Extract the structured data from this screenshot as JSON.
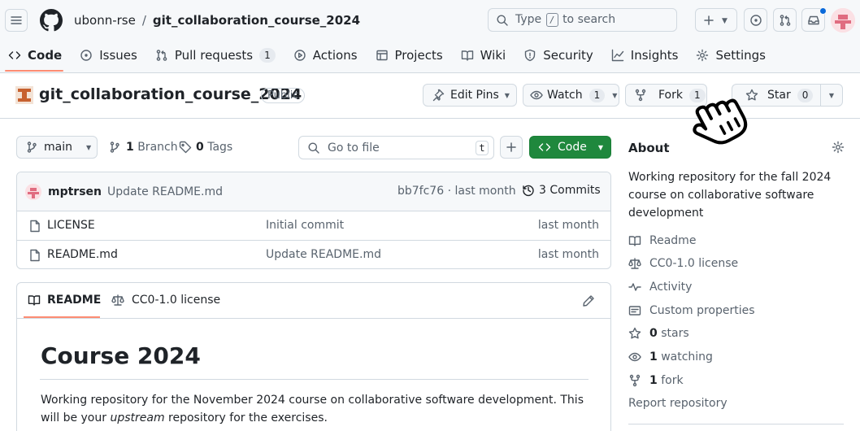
{
  "header": {
    "owner": "ubonn-rse",
    "separator": "/",
    "repo": "git_collaboration_course_2024",
    "search_pre": "Type",
    "search_key": "/",
    "search_post": "to search"
  },
  "nav": {
    "code": "Code",
    "issues": "Issues",
    "pull_requests": "Pull requests",
    "pull_requests_count": "1",
    "actions": "Actions",
    "projects": "Projects",
    "wiki": "Wiki",
    "security": "Security",
    "insights": "Insights",
    "settings": "Settings"
  },
  "repo_header": {
    "name": "git_collaboration_course_2024",
    "visibility": "Public",
    "edit_pins": "Edit Pins",
    "watch": "Watch",
    "watch_count": "1",
    "fork": "Fork",
    "fork_count": "1",
    "star": "Star",
    "star_count": "0"
  },
  "toolbar": {
    "branch": "main",
    "branch_count": "1",
    "branch_label": "Branch",
    "tag_count": "0",
    "tag_label": "Tags",
    "goto_placeholder": "Go to file",
    "goto_key": "t",
    "code_button": "Code"
  },
  "latest_commit": {
    "author": "mptrsen",
    "message": "Update README.md",
    "meta": "bb7fc76 · last month",
    "commits": "3 Commits"
  },
  "files": [
    {
      "name": "LICENSE",
      "message": "Initial commit",
      "date": "last month"
    },
    {
      "name": "README.md",
      "message": "Update README.md",
      "date": "last month"
    }
  ],
  "readme": {
    "tab_readme": "README",
    "tab_license": "CC0-1.0 license",
    "heading": "Course 2024",
    "para_pre": "Working repository for the November 2024 course on collaborative software development. This will be your ",
    "para_em": "upstream",
    "para_post": " repository for the exercises."
  },
  "about": {
    "title": "About",
    "description": "Working repository for the fall 2024 course on collaborative software development",
    "readme": "Readme",
    "license": "CC0-1.0 license",
    "activity": "Activity",
    "custom_properties": "Custom properties",
    "stars_count": "0",
    "stars_label": "stars",
    "watching_count": "1",
    "watching_label": "watching",
    "forks_count": "1",
    "forks_label": "fork",
    "report": "Report repository"
  },
  "colors": {
    "accent_underline": "#fd8c73",
    "primary_green": "#1f883d",
    "notification_blue": "#0969da"
  }
}
